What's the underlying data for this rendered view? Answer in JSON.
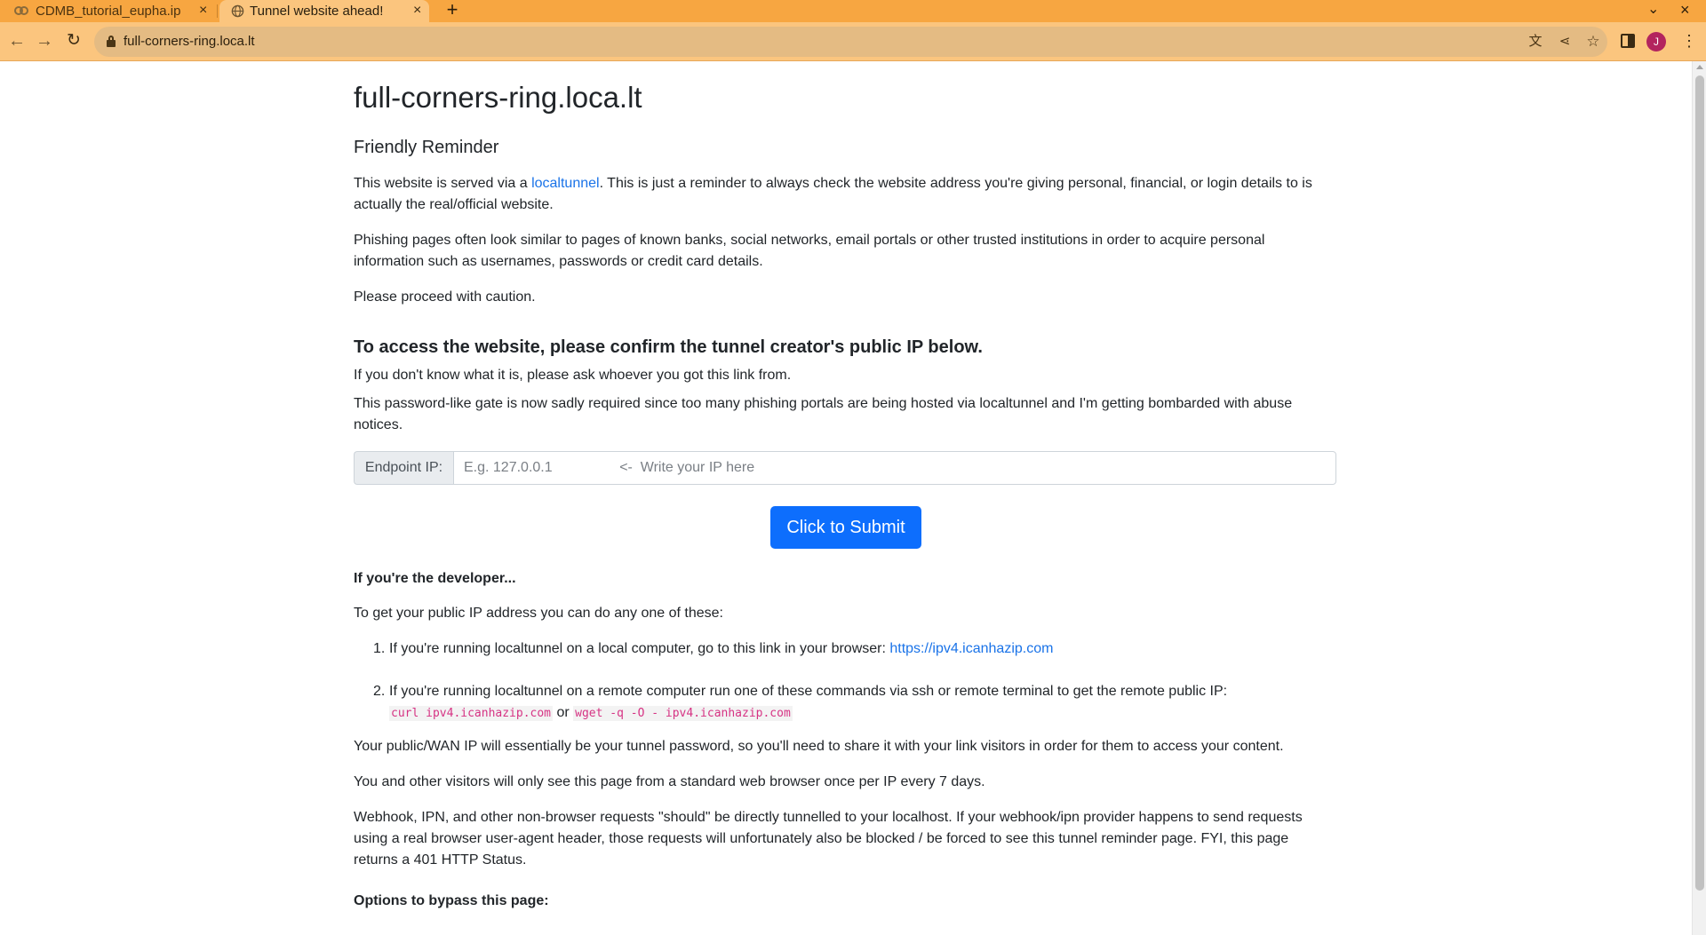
{
  "browser": {
    "tabs": [
      {
        "title": "CDMB_tutorial_eupha.ip",
        "active": false
      },
      {
        "title": "Tunnel website ahead!",
        "active": true
      }
    ],
    "new_tab_label": "+",
    "close_label": "×",
    "url": "full-corners-ring.loca.lt",
    "avatar_initial": "J",
    "accent_color": "#f7a641"
  },
  "page": {
    "title": "full-corners-ring.loca.lt",
    "reminder_heading": "Friendly Reminder",
    "intro": {
      "before_link": "This website is served via a ",
      "link": "localtunnel",
      "after_link": ". This is just a reminder to always check the website address you're giving personal, financial, or login details to is actually the real/official website."
    },
    "phishing_text": "Phishing pages often look similar to pages of known banks, social networks, email portals or other trusted institutions in order to acquire personal information such as usernames, passwords or credit card details.",
    "caution_text": "Please proceed with caution.",
    "access_heading": "To access the website, please confirm the tunnel creator's public IP below.",
    "ask_text": "If you don't know what it is, please ask whoever you got this link from.",
    "gate_text": "This password-like gate is now sadly required since too many phishing portals are being hosted via localtunnel and I'm getting bombarded with abuse notices.",
    "endpoint": {
      "label": "Endpoint IP:",
      "placeholder": "E.g. 127.0.0.1                 <-  Write your IP here",
      "value": ""
    },
    "submit_label": "Click to Submit",
    "developer_heading": "If you're the developer...",
    "public_ip_intro": "To get your public IP address you can do any one of these:",
    "steps": [
      {
        "num": "1.",
        "text": "If you're running localtunnel on a local computer, go to this link in your browser: ",
        "link": "https://ipv4.icanhazip.com"
      },
      {
        "num": "2.",
        "text": "If you're running localtunnel on a remote computer run one of these commands via ssh or remote terminal to get the remote public IP:",
        "cmd1": "curl ipv4.icanhazip.com",
        "or": "or",
        "cmd2": "wget -q -O - ipv4.icanhazip.com"
      }
    ],
    "wan_text": "Your public/WAN IP will essentially be your tunnel password, so you'll need to share it with your link visitors in order for them to access your content.",
    "visitors_text": "You and other visitors will only see this page from a standard web browser once per IP every 7 days.",
    "webhook_text": "Webhook, IPN, and other non-browser requests \"should\" be directly tunnelled to your localhost. If your webhook/ipn provider happens to send requests using a real browser user-agent header, those requests will unfortunately also be blocked / be forced to see this tunnel reminder page. FYI, this page returns a 401 HTTP Status.",
    "bypass_heading": "Options to bypass this page:"
  }
}
